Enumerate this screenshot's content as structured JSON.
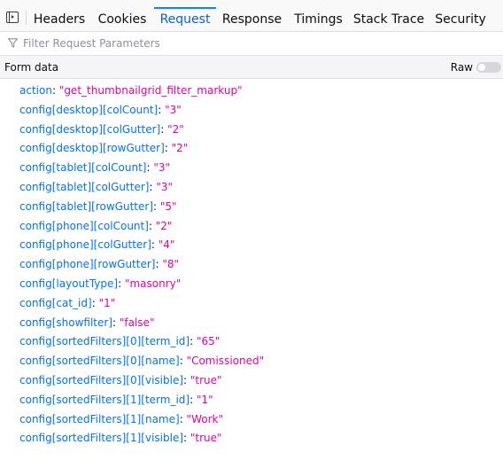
{
  "tabs": [
    {
      "label": "Headers",
      "selected": false
    },
    {
      "label": "Cookies",
      "selected": false
    },
    {
      "label": "Request",
      "selected": true
    },
    {
      "label": "Response",
      "selected": false
    },
    {
      "label": "Timings",
      "selected": false
    },
    {
      "label": "Stack Trace",
      "selected": false
    },
    {
      "label": "Security",
      "selected": false
    }
  ],
  "filter": {
    "placeholder": "Filter Request Parameters",
    "value": ""
  },
  "section": {
    "title": "Form data",
    "raw_label": "Raw",
    "raw_enabled": false
  },
  "params": [
    {
      "key": "action",
      "value": "\"get_thumbnailgrid_filter_markup\""
    },
    {
      "key": "config[desktop][colCount]",
      "value": "\"3\""
    },
    {
      "key": "config[desktop][colGutter]",
      "value": "\"2\""
    },
    {
      "key": "config[desktop][rowGutter]",
      "value": "\"2\""
    },
    {
      "key": "config[tablet][colCount]",
      "value": "\"3\""
    },
    {
      "key": "config[tablet][colGutter]",
      "value": "\"3\""
    },
    {
      "key": "config[tablet][rowGutter]",
      "value": "\"5\""
    },
    {
      "key": "config[phone][colCount]",
      "value": "\"2\""
    },
    {
      "key": "config[phone][colGutter]",
      "value": "\"4\""
    },
    {
      "key": "config[phone][rowGutter]",
      "value": "\"8\""
    },
    {
      "key": "config[layoutType]",
      "value": "\"masonry\""
    },
    {
      "key": "config[cat_id]",
      "value": "\"1\""
    },
    {
      "key": "config[showfilter]",
      "value": "\"false\""
    },
    {
      "key": "config[sortedFilters][0][term_id]",
      "value": "\"65\""
    },
    {
      "key": "config[sortedFilters][0][name]",
      "value": "\"Comissioned\""
    },
    {
      "key": "config[sortedFilters][0][visible]",
      "value": "\"true\""
    },
    {
      "key": "config[sortedFilters][1][term_id]",
      "value": "\"1\""
    },
    {
      "key": "config[sortedFilters][1][name]",
      "value": "\"Work\""
    },
    {
      "key": "config[sortedFilters][1][visible]",
      "value": "\"true\""
    }
  ],
  "colors": {
    "accent": "#0a84ff",
    "param_key": "#0074e8",
    "param_value": "#dd00a9"
  },
  "icons": {
    "panel_toggle": "sidebar-toggle-icon",
    "filter": "funnel-icon"
  }
}
